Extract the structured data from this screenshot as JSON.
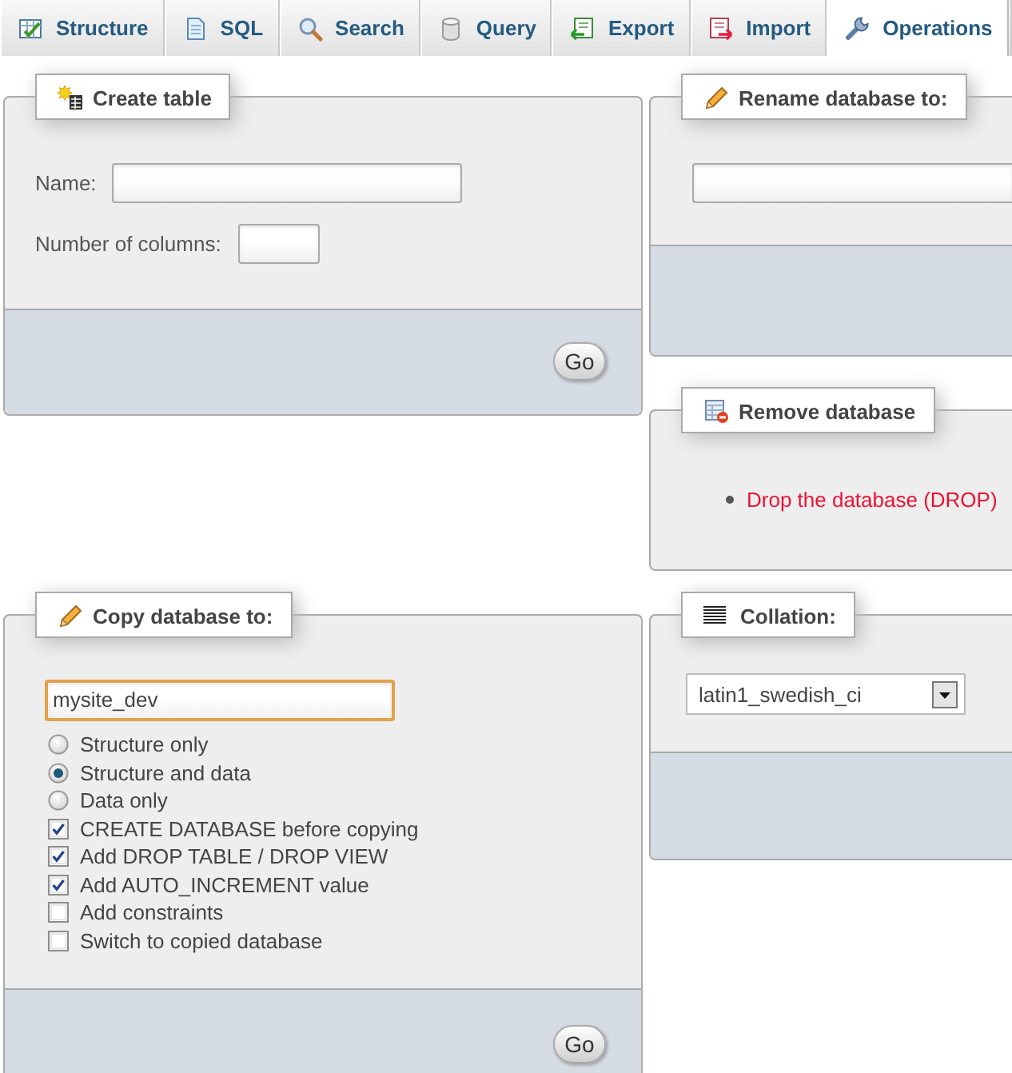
{
  "tabs": [
    {
      "label": "Structure",
      "selected": false
    },
    {
      "label": "SQL",
      "selected": false
    },
    {
      "label": "Search",
      "selected": false
    },
    {
      "label": "Query",
      "selected": false
    },
    {
      "label": "Export",
      "selected": false
    },
    {
      "label": "Import",
      "selected": false
    },
    {
      "label": "Operations",
      "selected": true
    }
  ],
  "create_table": {
    "title": "Create table",
    "fields": [
      {
        "label": "Name:",
        "kind": "text"
      },
      {
        "label": "Number of columns:",
        "kind": "number"
      }
    ],
    "button": "Go"
  },
  "rename_database": {
    "title": "Rename database to:"
  },
  "remove_database": {
    "title": "Remove database",
    "link": "Drop the database (DROP)"
  },
  "copy_database": {
    "title": "Copy database to:",
    "value": "mysite_dev",
    "focused": true,
    "radios": [
      {
        "label": "Structure only",
        "selected": false
      },
      {
        "label": "Structure and data",
        "selected": true
      },
      {
        "label": "Data only",
        "selected": false
      }
    ],
    "checkboxes": [
      {
        "label": "CREATE DATABASE before copying",
        "checked": true
      },
      {
        "label": "Add DROP TABLE / DROP VIEW",
        "checked": true
      },
      {
        "label": "Add AUTO_INCREMENT value",
        "checked": true
      },
      {
        "label": "Add constraints",
        "checked": false
      },
      {
        "label": "Switch to copied database",
        "checked": false
      }
    ],
    "button": "Go"
  },
  "collation": {
    "title": "Collation:",
    "value": "latin1_swedish_ci"
  }
}
